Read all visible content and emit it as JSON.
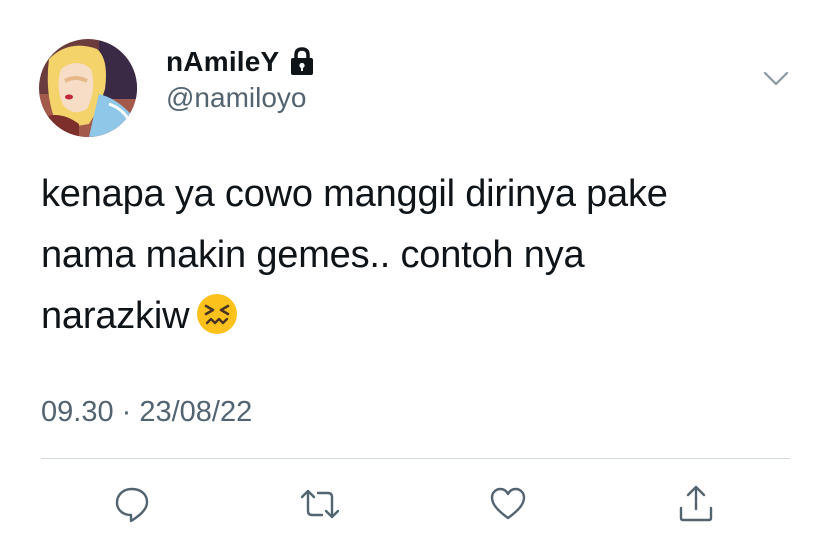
{
  "tweet": {
    "display_name": "nAmileY",
    "handle": "@namiloyo",
    "text_lines": [
      "kenapa ya cowo manggil dirinya pake",
      "nama makin gemes.. contoh nya",
      "narazkiw"
    ],
    "timestamp": "09.30 · 23/08/22"
  },
  "icons": {
    "lock": "lock-icon",
    "more": "chevron-down-icon",
    "emoji": "confounded-face-emoji",
    "reply": "reply-icon",
    "retweet": "retweet-icon",
    "like": "heart-icon",
    "share": "share-icon"
  },
  "colors": {
    "text": "#0f1419",
    "secondary": "#536471",
    "divider": "#cfd9de",
    "icon": "#536471"
  }
}
